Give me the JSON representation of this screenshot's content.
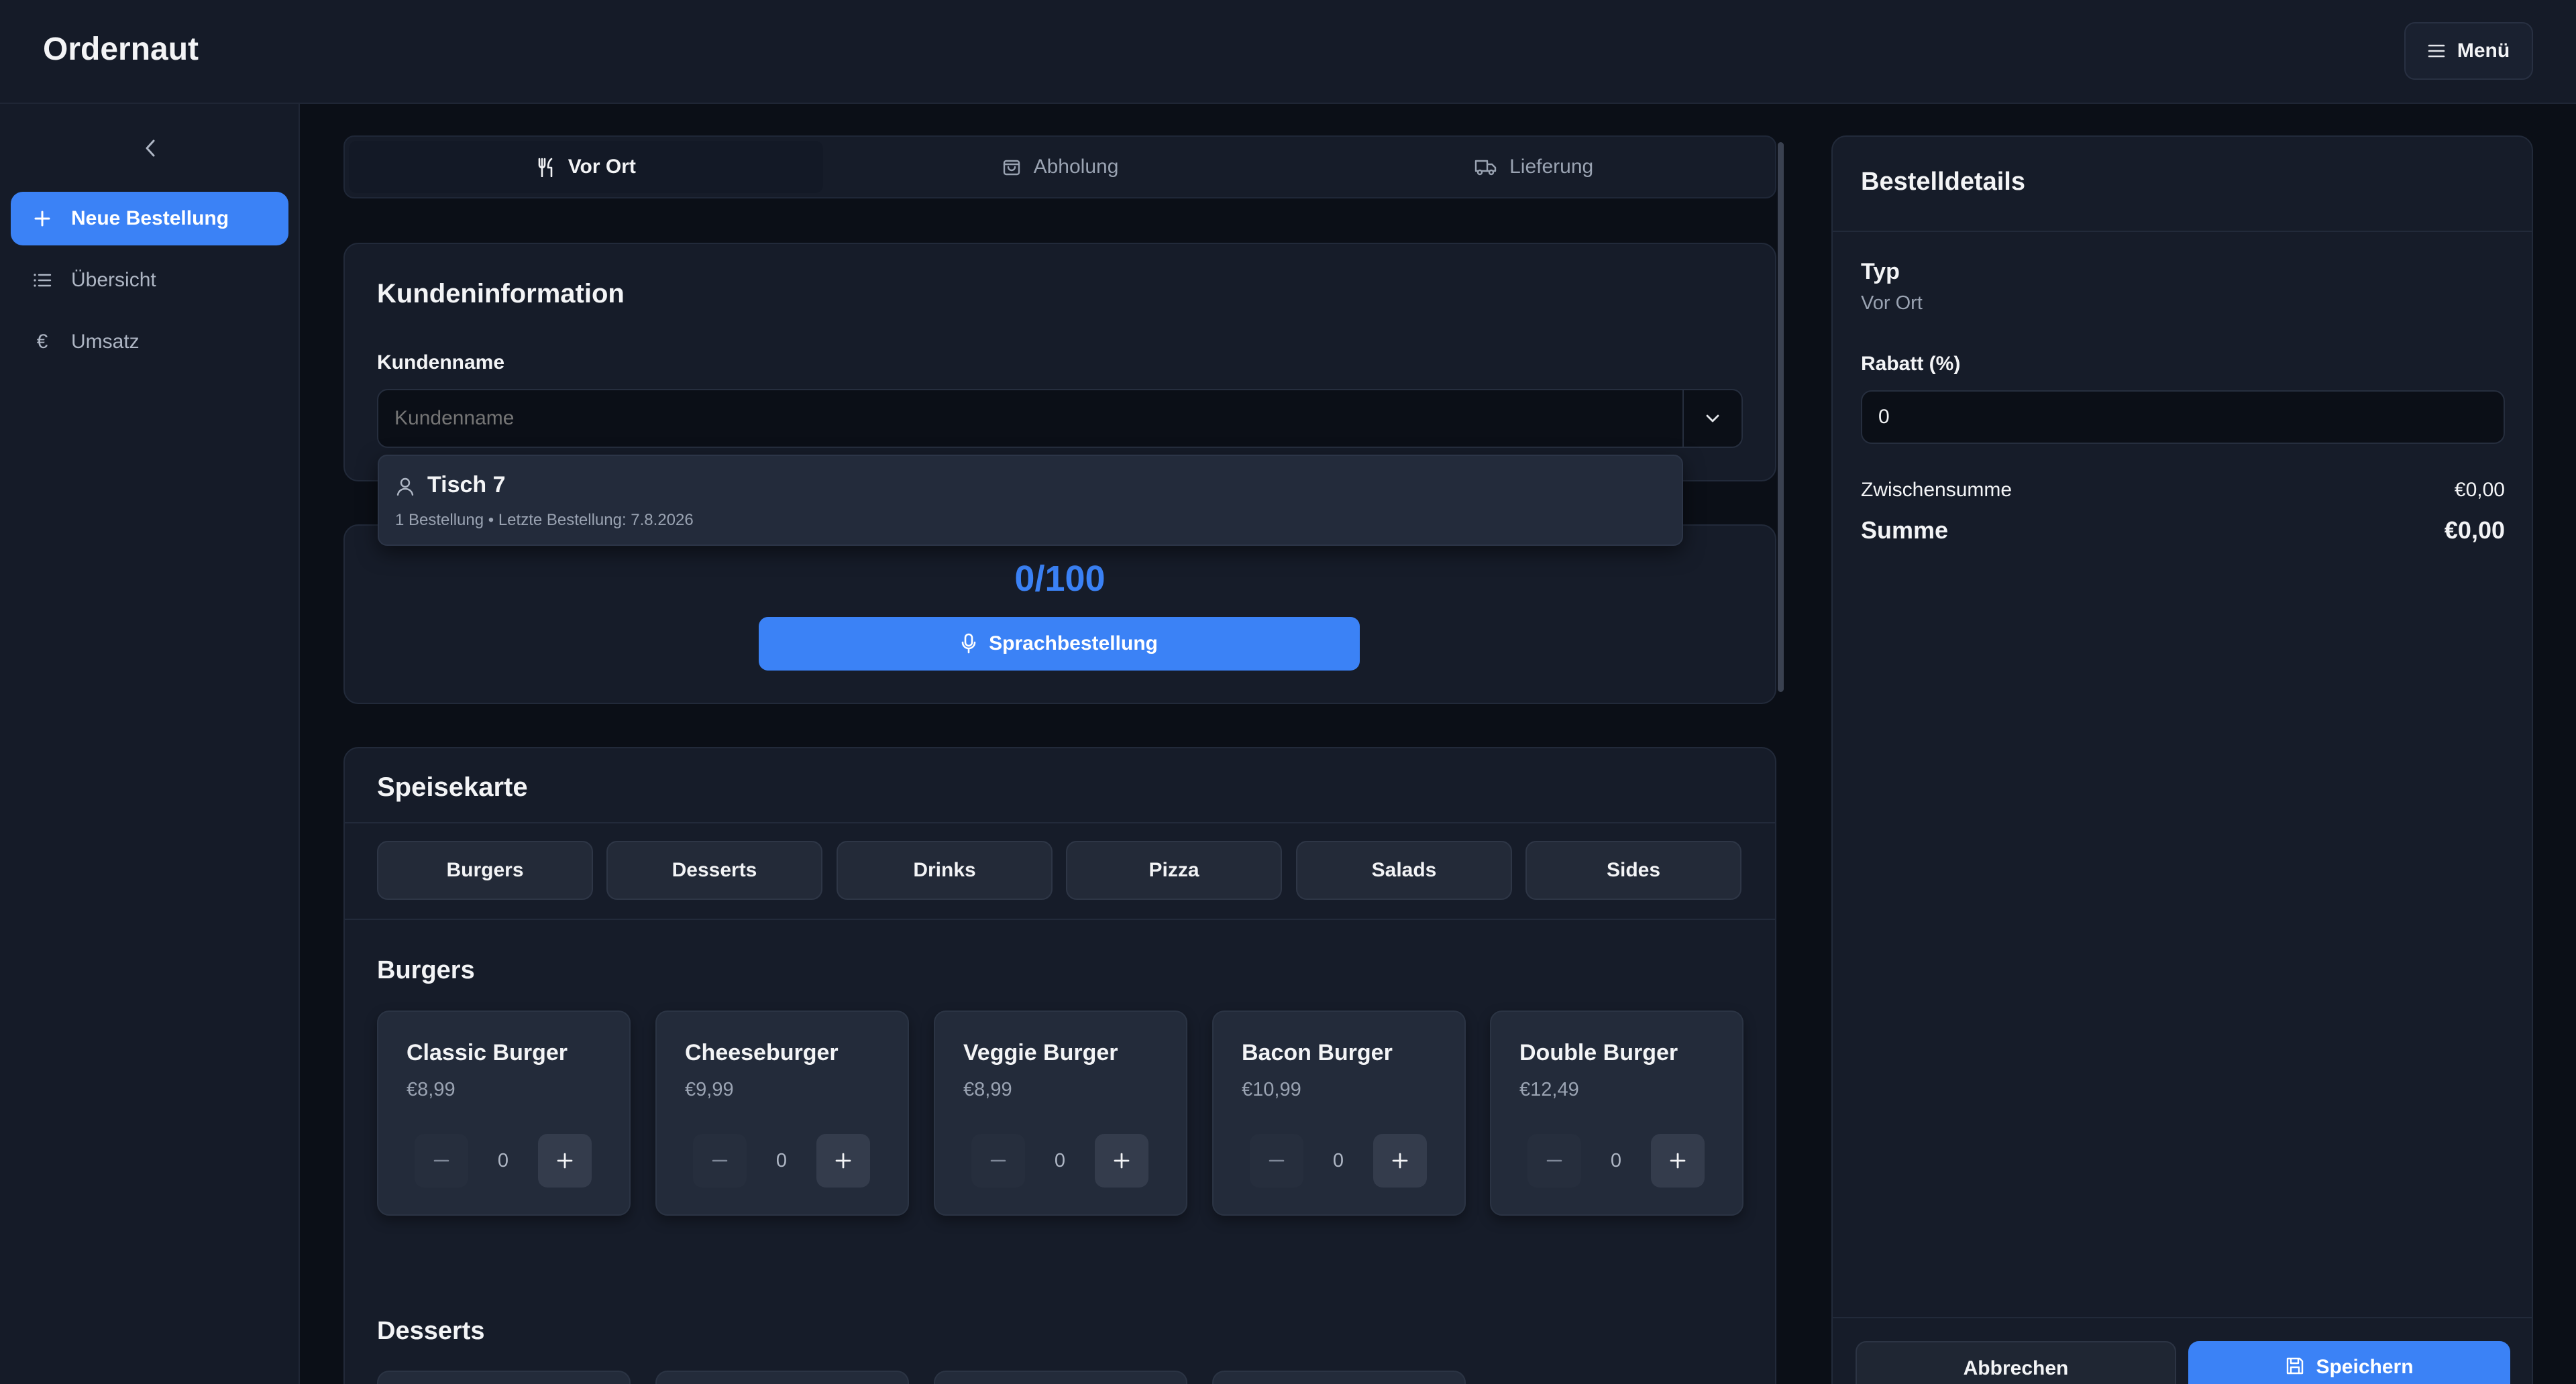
{
  "app": {
    "title": "Ordernaut",
    "menu_label": "Menü"
  },
  "sidebar": {
    "items": [
      {
        "label": "Neue Bestellung",
        "icon": "plus-icon",
        "active": true
      },
      {
        "label": "Übersicht",
        "icon": "list-icon",
        "active": false
      },
      {
        "label": "Umsatz",
        "icon": "euro-icon",
        "active": false
      }
    ],
    "euro_glyph": "€"
  },
  "order_types": [
    {
      "label": "Vor Ort",
      "icon": "utensils-icon",
      "active": true
    },
    {
      "label": "Abholung",
      "icon": "bag-icon",
      "active": false
    },
    {
      "label": "Lieferung",
      "icon": "truck-icon",
      "active": false
    }
  ],
  "customer": {
    "title": "Kundeninformation",
    "name_label": "Kundenname",
    "name_placeholder": "Kundenname",
    "name_value": "",
    "suggestion": {
      "name": "Tisch 7",
      "meta": "1 Bestellung • Letzte Bestellung: 7.8.2026"
    }
  },
  "voice": {
    "counter": "0/100",
    "button_label": "Sprachbestellung"
  },
  "menu": {
    "title": "Speisekarte",
    "categories": [
      "Burgers",
      "Desserts",
      "Drinks",
      "Pizza",
      "Salads",
      "Sides"
    ],
    "sections": [
      {
        "title": "Burgers",
        "items": [
          {
            "name": "Classic Burger",
            "price": "€8,99",
            "qty": "0"
          },
          {
            "name": "Cheeseburger",
            "price": "€9,99",
            "qty": "0"
          },
          {
            "name": "Veggie Burger",
            "price": "€8,99",
            "qty": "0"
          },
          {
            "name": "Bacon Burger",
            "price": "€10,99",
            "qty": "0"
          },
          {
            "name": "Double Burger",
            "price": "€12,49",
            "qty": "0"
          }
        ]
      },
      {
        "title": "Desserts"
      }
    ]
  },
  "details": {
    "title": "Bestelldetails",
    "type_label": "Typ",
    "type_value": "Vor Ort",
    "discount_label": "Rabatt (%)",
    "discount_value": "0",
    "subtotal_label": "Zwischensumme",
    "subtotal_value": "€0,00",
    "total_label": "Summe",
    "total_value": "€0,00",
    "cancel_label": "Abbrechen",
    "save_label": "Speichern"
  },
  "colors": {
    "accent": "#3b82f6",
    "background": "#0b0f17",
    "panel": "#161c29"
  }
}
